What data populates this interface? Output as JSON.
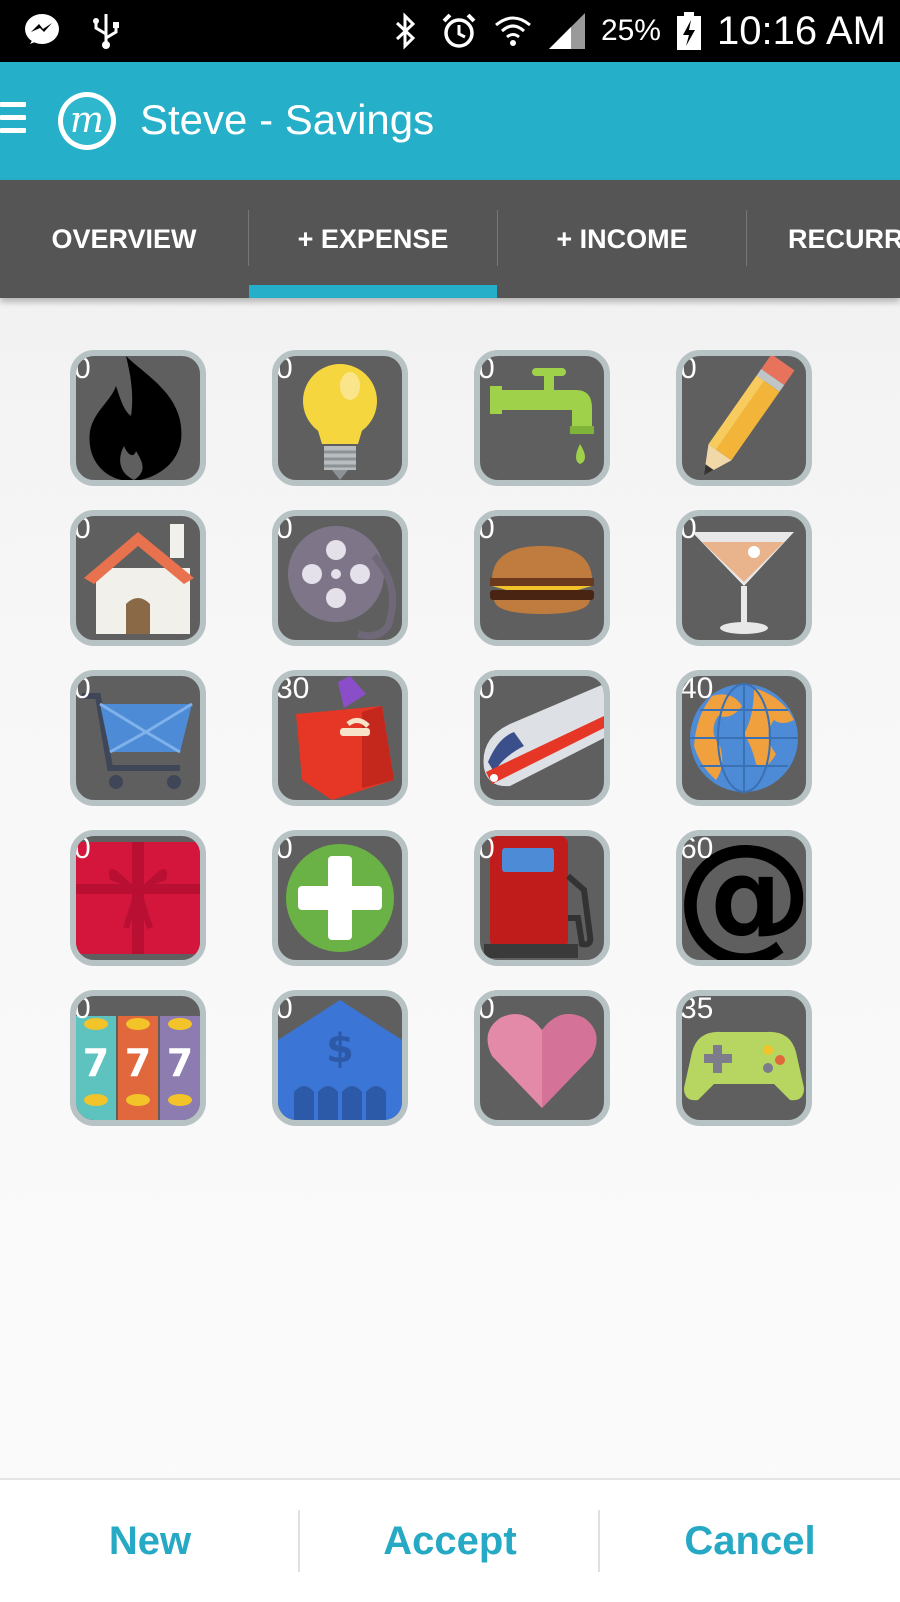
{
  "status_bar": {
    "battery_percent": "25%",
    "time": "10:16 AM"
  },
  "app_bar": {
    "title": "Steve - Savings",
    "logo_letter": "m"
  },
  "tabs": [
    {
      "label": "OVERVIEW",
      "selected": false
    },
    {
      "label": "+ EXPENSE",
      "selected": true
    },
    {
      "label": "+ INCOME",
      "selected": false
    },
    {
      "label": "RECURR",
      "selected": false
    }
  ],
  "categories": [
    {
      "icon": "fire-icon",
      "count": "0"
    },
    {
      "icon": "lightbulb-icon",
      "count": "0"
    },
    {
      "icon": "water-faucet-icon",
      "count": "0"
    },
    {
      "icon": "pencil-icon",
      "count": "0"
    },
    {
      "icon": "house-icon",
      "count": "0"
    },
    {
      "icon": "film-reel-icon",
      "count": "0"
    },
    {
      "icon": "burger-icon",
      "count": "0"
    },
    {
      "icon": "cocktail-icon",
      "count": "0"
    },
    {
      "icon": "shopping-cart-icon",
      "count": "0"
    },
    {
      "icon": "shopping-bag-icon",
      "count": "30"
    },
    {
      "icon": "train-icon",
      "count": "0"
    },
    {
      "icon": "globe-icon",
      "count": "40"
    },
    {
      "icon": "gift-icon",
      "count": "0"
    },
    {
      "icon": "medical-plus-icon",
      "count": "0"
    },
    {
      "icon": "gas-pump-icon",
      "count": "0"
    },
    {
      "icon": "at-sign-icon",
      "count": "60"
    },
    {
      "icon": "slot-machine-icon",
      "count": "0"
    },
    {
      "icon": "bank-icon",
      "count": "0"
    },
    {
      "icon": "heart-icon",
      "count": "0"
    },
    {
      "icon": "gamepad-icon",
      "count": "35"
    }
  ],
  "bottom_bar": {
    "new_label": "New",
    "accept_label": "Accept",
    "cancel_label": "Cancel"
  },
  "colors": {
    "accent": "#25afc9",
    "tab_bar": "#555555",
    "tile_bg": "#5f5f5f",
    "tile_border": "#b7c2c4"
  }
}
